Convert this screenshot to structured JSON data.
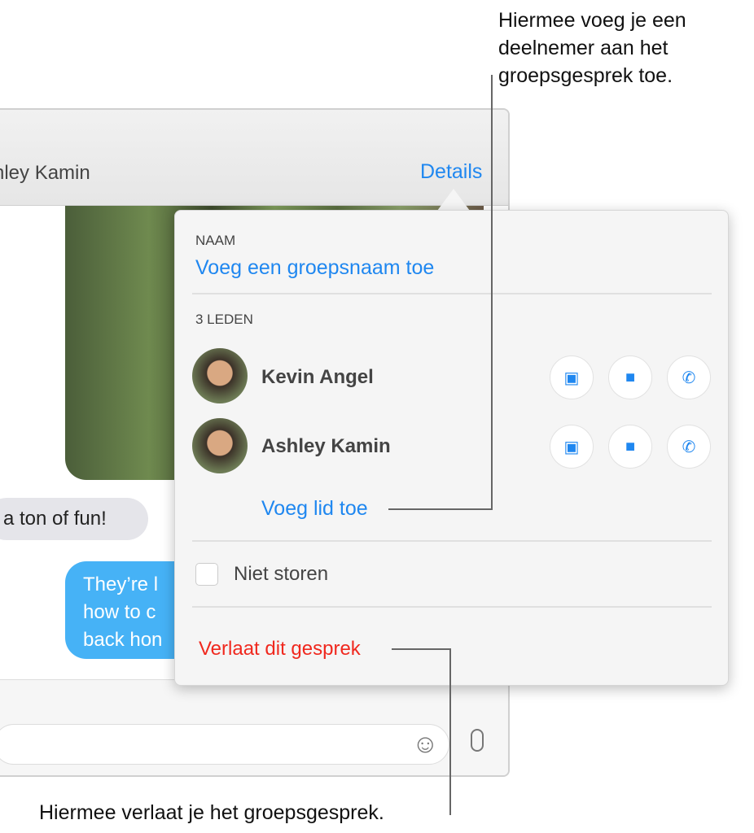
{
  "conversation": {
    "header_name": "hley Kamin",
    "details_label": "Details",
    "messages": [
      {
        "from": "other",
        "text": "a ton of fun!"
      },
      {
        "from": "me",
        "text": "They’re l\nhow to c\nback hon"
      }
    ]
  },
  "popover": {
    "name_label": "NAAM",
    "name_placeholder": "Voeg een groepsnaam toe",
    "members_label": "3 LEDEN",
    "members": [
      {
        "name": "Kevin Angel"
      },
      {
        "name": "Ashley Kamin"
      }
    ],
    "member_actions": [
      "message-icon",
      "video-icon",
      "phone-icon"
    ],
    "add_member": "Voeg lid toe",
    "do_not_disturb": {
      "label": "Niet storen",
      "checked": false
    },
    "leave": "Verlaat dit gesprek"
  },
  "callouts": {
    "add": "Hiermee voeg je een deelnemer aan het groepsgesprek toe.",
    "leave": "Hiermee verlaat je het groepsgesprek."
  },
  "colors": {
    "accent": "#1f87f0",
    "destructive": "#f0281e",
    "bubble_me": "#46b2f6",
    "bubble_other": "#e5e5ea"
  }
}
